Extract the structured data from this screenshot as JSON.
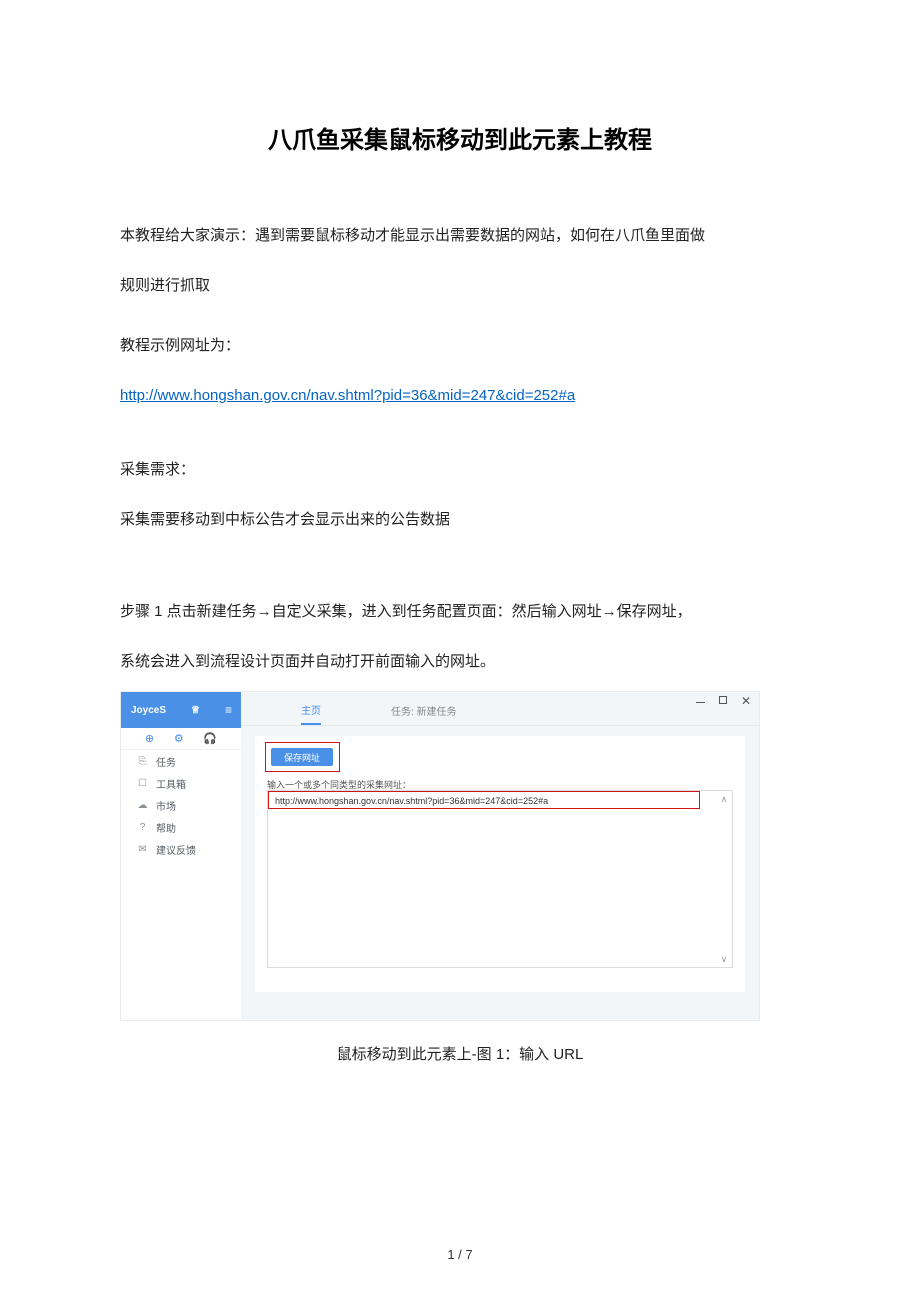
{
  "doc": {
    "title": "八爪鱼采集鼠标移动到此元素上教程",
    "intro1": "本教程给大家演示：遇到需要鼠标移动才能显示出需要数据的网站，如何在八爪鱼里面做",
    "intro2": "规则进行抓取",
    "example_label": "教程示例网址为：",
    "url": "http://www.hongshan.gov.cn/nav.shtml?pid=36&mid=247&cid=252#a",
    "need_label": "采集需求：",
    "need_text": "采集需要移动到中标公告才会显示出来的公告数据",
    "step1_a": "步骤 1  点击新建任务→自定义采集，进入到任务配置页面：然后输入网址→保存网址，",
    "step1_b": "系统会进入到流程设计页面并自动打开前面输入的网址。",
    "caption": "鼠标移动到此元素上-图 1：输入 URL",
    "page_num": "1 / 7"
  },
  "app": {
    "brand": "JoyceS",
    "crown": "♕",
    "hamburger": "≡",
    "icons": {
      "plus": "⊕",
      "gear": "⚙",
      "bell": "🎧"
    },
    "sidebar": [
      {
        "icon": "⎘",
        "label": "任务"
      },
      {
        "icon": "☐",
        "label": "工具箱"
      },
      {
        "icon": "☁",
        "label": "市场"
      },
      {
        "icon": "?",
        "label": "帮助"
      },
      {
        "icon": "✉",
        "label": "建议反馈"
      }
    ],
    "tabs": {
      "home": "主页",
      "task": "任务: 新建任务"
    },
    "save_btn": "保存网址",
    "url_hint": "输入一个或多个同类型的采集网址：",
    "url_value": "http://www.hongshan.gov.cn/nav.shtml?pid=36&mid=247&cid=252#a",
    "scroll_up": "∧",
    "scroll_down": "∨",
    "win_close": "✕"
  }
}
